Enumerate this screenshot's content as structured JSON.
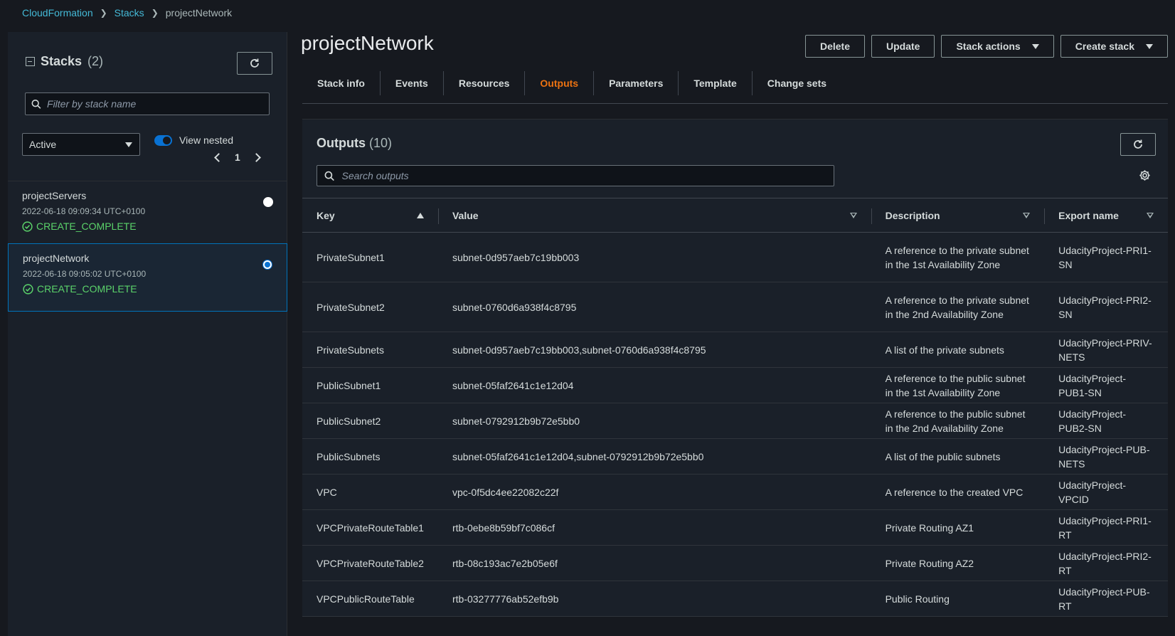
{
  "breadcrumb": {
    "item1": "CloudFormation",
    "item2": "Stacks",
    "current": "projectNetwork"
  },
  "sidebar": {
    "title": "Stacks",
    "count": "(2)",
    "filter_placeholder": "Filter by stack name",
    "status_filter": "Active",
    "view_nested_label": "View nested",
    "page": "1",
    "stacks": [
      {
        "name": "projectServers",
        "date": "2022-06-18 09:09:34 UTC+0100",
        "status": "CREATE_COMPLETE",
        "selected": false
      },
      {
        "name": "projectNetwork",
        "date": "2022-06-18 09:05:02 UTC+0100",
        "status": "CREATE_COMPLETE",
        "selected": true
      }
    ]
  },
  "main": {
    "title": "projectNetwork",
    "actions": {
      "delete": "Delete",
      "update": "Update",
      "stack_actions": "Stack actions",
      "create_stack": "Create stack"
    },
    "tabs": [
      "Stack info",
      "Events",
      "Resources",
      "Outputs",
      "Parameters",
      "Template",
      "Change sets"
    ],
    "active_tab": "Outputs",
    "outputs": {
      "title": "Outputs",
      "count": "(10)",
      "search_placeholder": "Search outputs",
      "columns": {
        "key": "Key",
        "value": "Value",
        "description": "Description",
        "export": "Export name"
      },
      "rows": [
        {
          "key": "PrivateSubnet1",
          "value": "subnet-0d957aeb7c19bb003",
          "description": "A reference to the private subnet in the 1st Availability Zone",
          "export": "UdacityProject-PRI1-SN"
        },
        {
          "key": "PrivateSubnet2",
          "value": "subnet-0760d6a938f4c8795",
          "description": "A reference to the private subnet in the 2nd Availability Zone",
          "export": "UdacityProject-PRI2-SN"
        },
        {
          "key": "PrivateSubnets",
          "value": "subnet-0d957aeb7c19bb003,subnet-0760d6a938f4c8795",
          "description": "A list of the private subnets",
          "export": "UdacityProject-PRIV-NETS"
        },
        {
          "key": "PublicSubnet1",
          "value": "subnet-05faf2641c1e12d04",
          "description": "A reference to the public subnet in the 1st Availability Zone",
          "export": "UdacityProject-PUB1-SN"
        },
        {
          "key": "PublicSubnet2",
          "value": "subnet-0792912b9b72e5bb0",
          "description": "A reference to the public subnet in the 2nd Availability Zone",
          "export": "UdacityProject-PUB2-SN"
        },
        {
          "key": "PublicSubnets",
          "value": "subnet-05faf2641c1e12d04,subnet-0792912b9b72e5bb0",
          "description": "A list of the public subnets",
          "export": "UdacityProject-PUB-NETS"
        },
        {
          "key": "VPC",
          "value": "vpc-0f5dc4ee22082c22f",
          "description": "A reference to the created VPC",
          "export": "UdacityProject-VPCID"
        },
        {
          "key": "VPCPrivateRouteTable1",
          "value": "rtb-0ebe8b59bf7c086cf",
          "description": "Private Routing AZ1",
          "export": "UdacityProject-PRI1-RT"
        },
        {
          "key": "VPCPrivateRouteTable2",
          "value": "rtb-08c193ac7e2b05e6f",
          "description": "Private Routing AZ2",
          "export": "UdacityProject-PRI2-RT"
        },
        {
          "key": "VPCPublicRouteTable",
          "value": "rtb-03277776ab52efb9b",
          "description": "Public Routing",
          "export": "UdacityProject-PUB-RT"
        }
      ]
    }
  },
  "colors": {
    "background": "#16191f",
    "link": "#44b9d6",
    "active_tab": "#ec7211",
    "success": "#5bd36a",
    "selected_border": "#0073bb"
  }
}
